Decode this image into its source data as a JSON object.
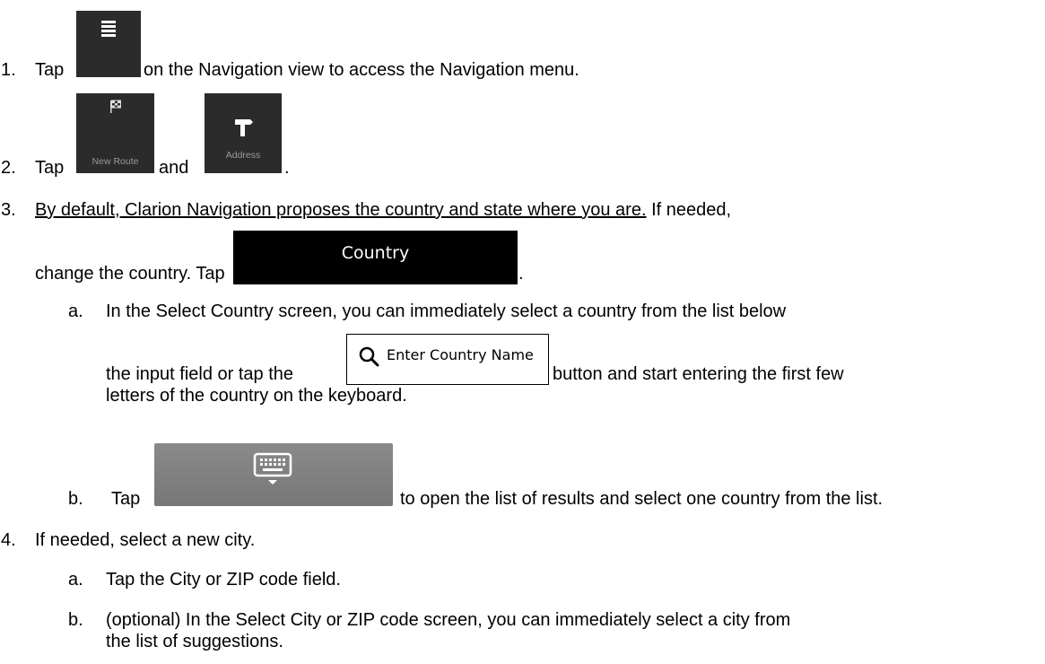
{
  "steps": {
    "s1": {
      "num": "1.",
      "tap": "Tap",
      "after": "on the Navigation view to access the Navigation menu."
    },
    "s2": {
      "num": "2.",
      "tap": "Tap",
      "and": "and",
      "end": ".",
      "new_route_label": "New Route",
      "address_label": "Address"
    },
    "s3": {
      "num": "3.",
      "line1_a": "By default, Clarion Navigation proposes the country and state where you are.",
      "line1_b": "If needed,",
      "line2_a": "change the country. Tap",
      "line2_end": ".",
      "country_button": "Country",
      "a": {
        "letter": "a.",
        "line1_a": "In the Select Country screen, you can immediately select a country from the list below",
        "line2_a": "the input field or tap the",
        "line2_b": "button and start entering the first few",
        "line3": "letters of the country on the keyboard.",
        "search_placeholder": "Enter Country Name"
      },
      "b": {
        "letter": "b.",
        "tap": "Tap",
        "after": "to open the list of results and select one country from the list."
      }
    },
    "s4": {
      "num": "4.",
      "text": "If needed, select a new city.",
      "a": {
        "letter": "a.",
        "text": "Tap the City or ZIP code field."
      },
      "b": {
        "letter": "b.",
        "line1": "(optional) In the Select City or ZIP code screen, you can immediately select a city from",
        "line2": "the list of suggestions."
      }
    }
  }
}
